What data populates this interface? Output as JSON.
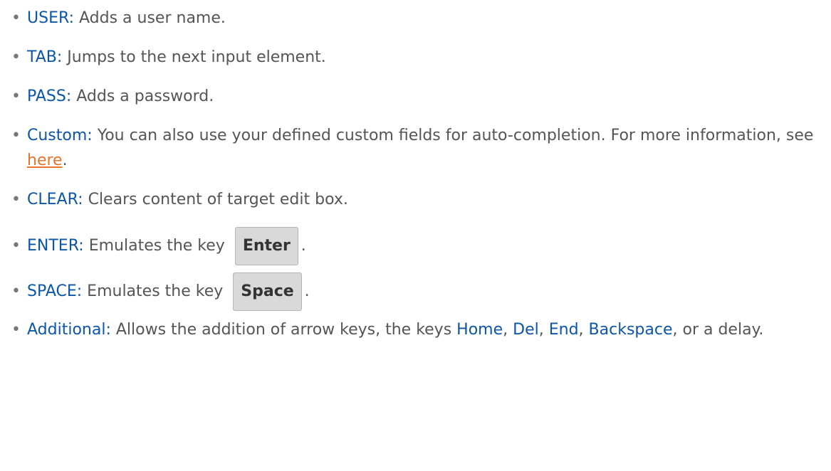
{
  "bullet": "•",
  "items": [
    {
      "term": "USER:",
      "desc": " Adds a user name."
    },
    {
      "term": "TAB:",
      "desc": " Jumps to the next input element."
    },
    {
      "term": "PASS:",
      "desc": " Adds a password."
    },
    {
      "term": "Custom:",
      "desc_before": " You can also use your defined custom fields for auto-completion. For more information, see ",
      "link": "here",
      "desc_after": "."
    },
    {
      "term": "CLEAR:",
      "desc": " Clears content of target edit box."
    },
    {
      "term": "ENTER:",
      "desc": " Emulates the key",
      "key": "Enter",
      "after": "."
    },
    {
      "term": "SPACE:",
      "desc": " Emulates the key",
      "key": "Space",
      "after": "."
    },
    {
      "term": "Additional:",
      "desc1": " Allows the addition of arrow keys, the keys ",
      "k1": "Home",
      "s1": ", ",
      "k2": "Del",
      "s2": ", ",
      "k3": "End",
      "s3": ", ",
      "k4": "Backspace",
      "desc2": ", or a delay."
    }
  ]
}
